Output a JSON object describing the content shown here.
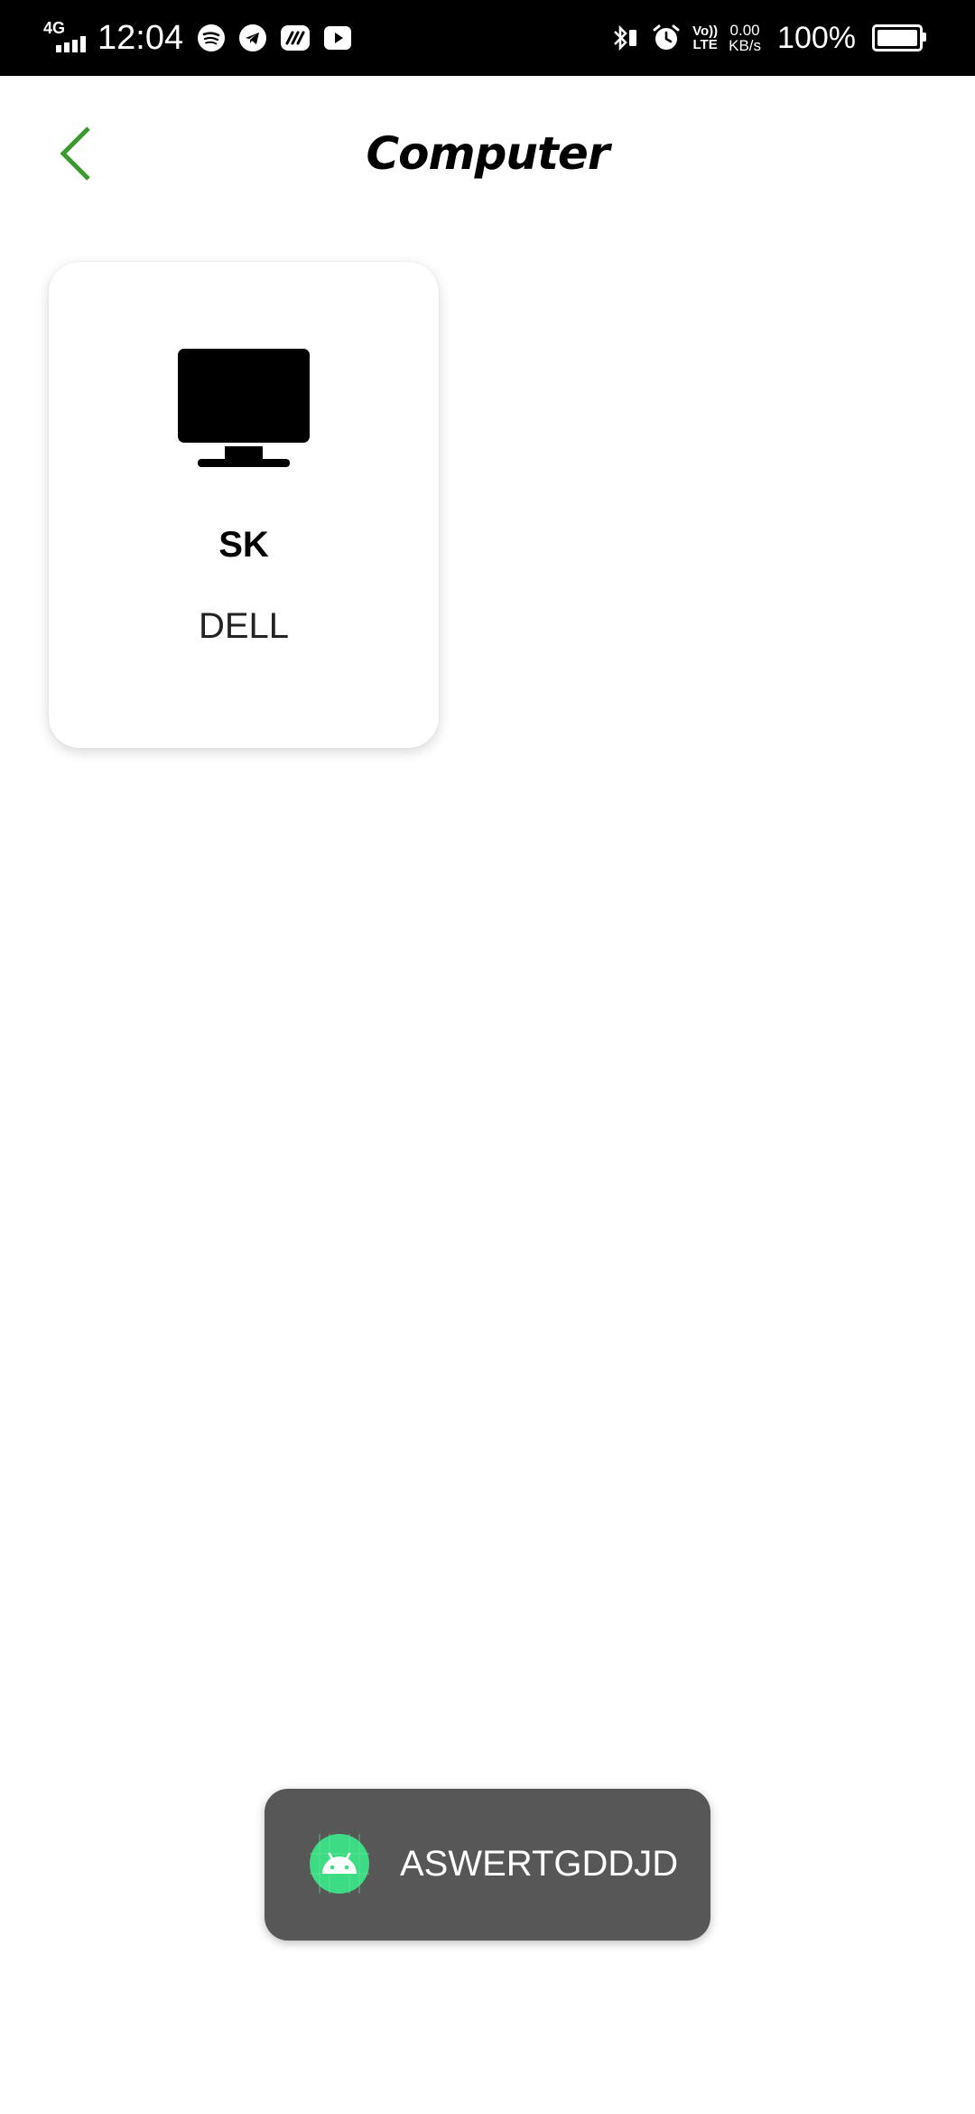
{
  "status_bar": {
    "network": "4G",
    "time": "12:04",
    "volte_top": "Vo))",
    "volte_bottom": "LTE",
    "speed_value": "0.00",
    "speed_unit": "KB/s",
    "battery_percent": "100%",
    "notification_icons": [
      "spotify-icon",
      "telegram-icon",
      "paytm-icon",
      "youtube-icon"
    ]
  },
  "header": {
    "title": "Computer",
    "back_icon": "chevron-left-icon",
    "accent_color": "#3a9a2e"
  },
  "devices": [
    {
      "icon": "monitor-icon",
      "name": "SK",
      "brand": "DELL"
    }
  ],
  "toast": {
    "message": "ASWERTGDDJD",
    "icon": "android-icon",
    "icon_color": "#3ddc84"
  }
}
